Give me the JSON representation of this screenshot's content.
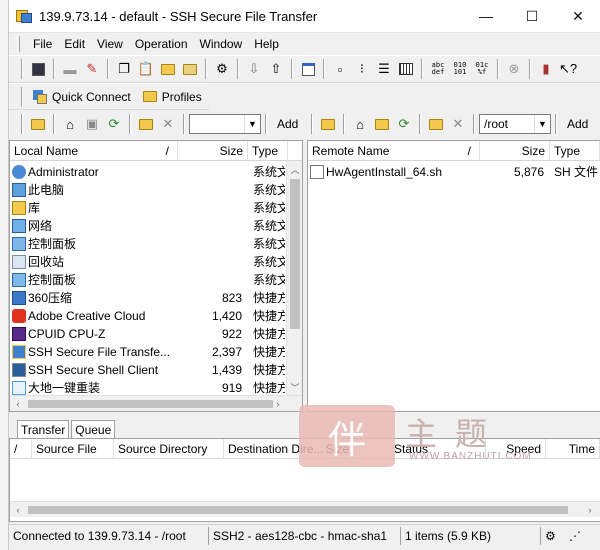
{
  "window": {
    "title": "139.9.73.14 - default - SSH Secure File Transfer",
    "minimize": "—",
    "maximize": "☐",
    "close": "✕"
  },
  "menu": [
    "File",
    "Edit",
    "View",
    "Operation",
    "Window",
    "Help"
  ],
  "quick": {
    "connect": "Quick Connect",
    "profiles": "Profiles"
  },
  "left": {
    "add": "Add",
    "path": "",
    "headers": {
      "name": "Local Name",
      "sort": "/",
      "size": "Size",
      "type": "Type"
    },
    "rows": [
      {
        "name": "Administrator",
        "size": "",
        "type": "系统文件夹",
        "icon": "user-icon"
      },
      {
        "name": "此电脑",
        "size": "",
        "type": "系统文件夹",
        "icon": "computer-icon"
      },
      {
        "name": "库",
        "size": "",
        "type": "系统文件夹",
        "icon": "library-icon"
      },
      {
        "name": "网络",
        "size": "",
        "type": "系统文件夹",
        "icon": "network-icon"
      },
      {
        "name": "控制面板",
        "size": "",
        "type": "系统文件夹",
        "icon": "control-panel-icon"
      },
      {
        "name": "回收站",
        "size": "",
        "type": "系统文件夹",
        "icon": "recycle-bin-icon"
      },
      {
        "name": "控制面板",
        "size": "",
        "type": "系统文件夹",
        "icon": "control-panel-icon"
      },
      {
        "name": "360压缩",
        "size": "823",
        "type": "快捷方式",
        "icon": "zip-icon"
      },
      {
        "name": "Adobe Creative Cloud",
        "size": "1,420",
        "type": "快捷方式",
        "icon": "adobe-icon"
      },
      {
        "name": "CPUID CPU-Z",
        "size": "922",
        "type": "快捷方式",
        "icon": "cpuz-icon"
      },
      {
        "name": "SSH Secure File Transfe...",
        "size": "2,397",
        "type": "快捷方式",
        "icon": "ssh-file-icon"
      },
      {
        "name": "SSH Secure Shell Client",
        "size": "1,439",
        "type": "快捷方式",
        "icon": "ssh-shell-icon"
      },
      {
        "name": "大地一键重装",
        "size": "919",
        "type": "快捷方式",
        "icon": "installer-icon"
      }
    ]
  },
  "right": {
    "add": "Add",
    "path": "/root",
    "headers": {
      "name": "Remote Name",
      "sort": "/",
      "size": "Size",
      "type": "Type"
    },
    "rows": [
      {
        "name": "HwAgentInstall_64.sh",
        "size": "5,876",
        "type": "SH 文件",
        "icon": "file-icon"
      }
    ]
  },
  "transfer": {
    "tabs": [
      "Transfer",
      "Queue"
    ],
    "headers": [
      "/",
      "Source File",
      "Source Directory",
      "Destination Dire...",
      "Size",
      "Status",
      "Speed",
      "Time"
    ]
  },
  "status": {
    "connection": "Connected to 139.9.73.14 - /root",
    "cipher": "SSH2 - aes128-cbc - hmac-sha1",
    "items": "1 items (5.9 KB)"
  },
  "watermark": {
    "seal": "伴",
    "chars": "主题",
    "url": "WWW.BANZHUTI.COM"
  }
}
